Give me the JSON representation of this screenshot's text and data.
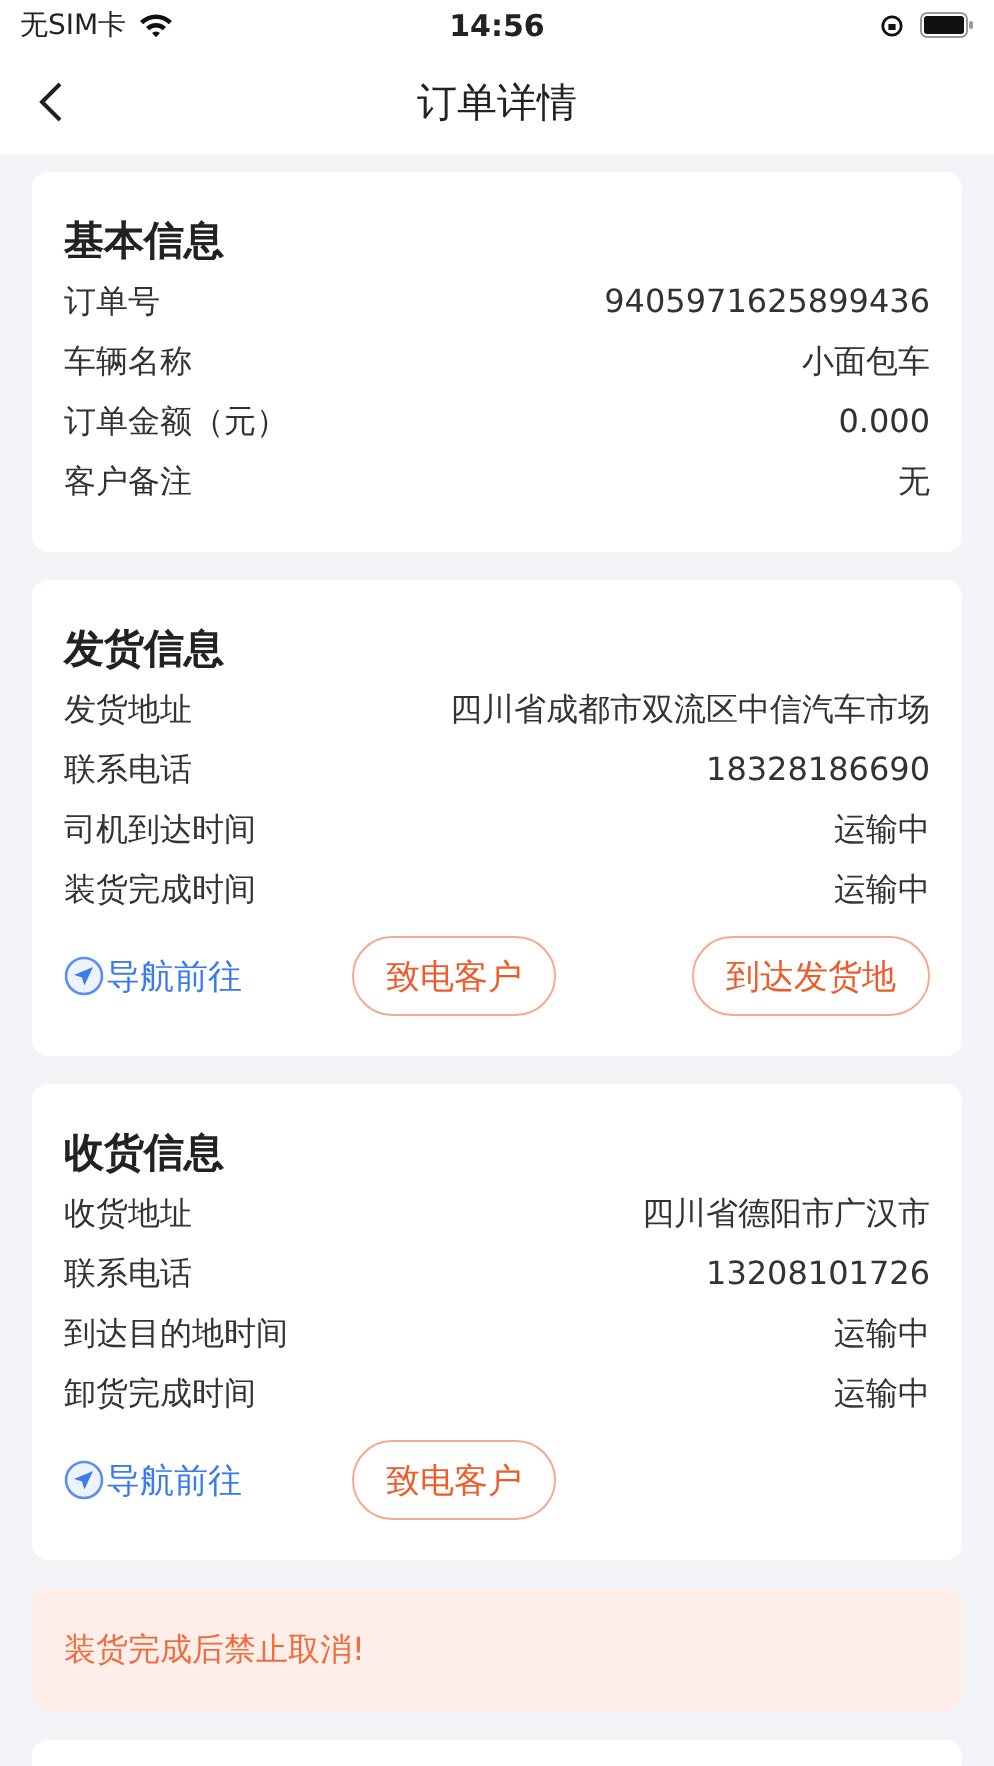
{
  "status_bar": {
    "carrier": "无SIM卡",
    "time": "14:56"
  },
  "nav": {
    "title": "订单详情"
  },
  "sections": [
    {
      "title": "基本信息",
      "rows": [
        {
          "label": "订单号",
          "value": "9405971625899436"
        },
        {
          "label": "车辆名称",
          "value": "小面包车"
        },
        {
          "label": "订单金额（元）",
          "value": "0.000"
        },
        {
          "label": "客户备注",
          "value": "无"
        }
      ]
    },
    {
      "title": "发货信息",
      "rows": [
        {
          "label": "发货地址",
          "value": "四川省成都市双流区中信汽车市场"
        },
        {
          "label": "联系电话",
          "value": "18328186690"
        },
        {
          "label": "司机到达时间",
          "value": "运输中"
        },
        {
          "label": "装货完成时间",
          "value": "运输中"
        }
      ],
      "navigate": "导航前往",
      "buttons": [
        "致电客户",
        "到达发货地"
      ]
    },
    {
      "title": "收货信息",
      "rows": [
        {
          "label": "收货地址",
          "value": "四川省德阳市广汉市"
        },
        {
          "label": "联系电话",
          "value": "13208101726"
        },
        {
          "label": "到达目的地时间",
          "value": "运输中"
        },
        {
          "label": "卸货完成时间",
          "value": "运输中"
        }
      ],
      "navigate": "导航前往",
      "buttons": [
        "致电客户"
      ]
    }
  ],
  "notice": "装货完成后禁止取消!"
}
